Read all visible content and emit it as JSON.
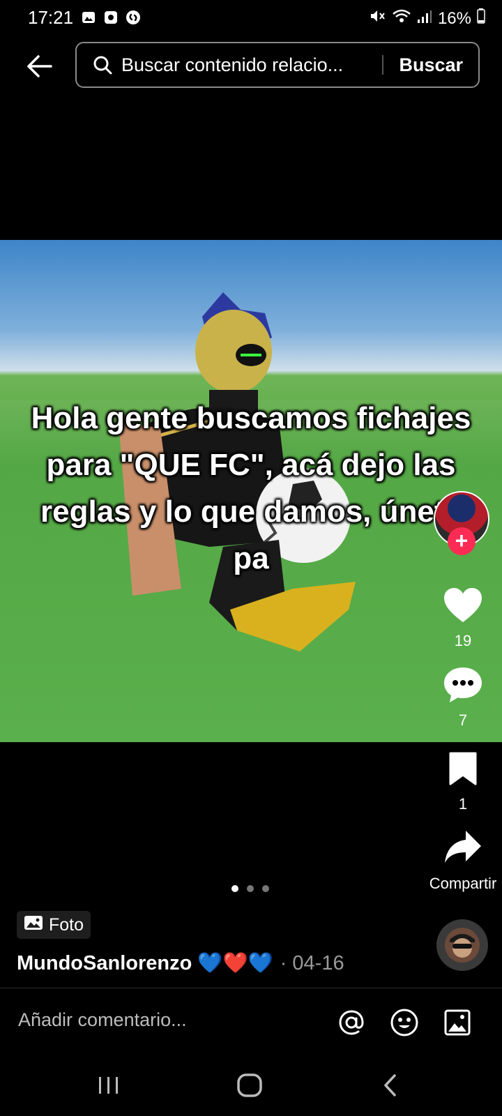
{
  "status_bar": {
    "time": "17:21",
    "battery": "16%"
  },
  "search": {
    "placeholder": "Buscar contenido relacio...",
    "button_label": "Buscar"
  },
  "post": {
    "overlay_text": "Hola gente buscamos fichajes para \"QUE FC\", acá dejo las reglas y lo que damos, únete pa",
    "likes": "19",
    "comments": "7",
    "saves": "1",
    "share_label": "Compartir",
    "badge_label": "Foto",
    "author": "MundoSanlorenzo 💙❤️💙",
    "date": "· 04-16",
    "slide_count": 3,
    "active_slide": 1
  },
  "comment_bar": {
    "placeholder": "Añadir comentario..."
  },
  "colors": {
    "accent": "#fe2c55",
    "background": "#000000"
  },
  "icons": [
    "back-arrow-icon",
    "search-icon",
    "heart-icon",
    "comment-icon",
    "bookmark-icon",
    "share-icon",
    "photo-icon",
    "mention-icon",
    "emoji-icon",
    "image-icon"
  ]
}
